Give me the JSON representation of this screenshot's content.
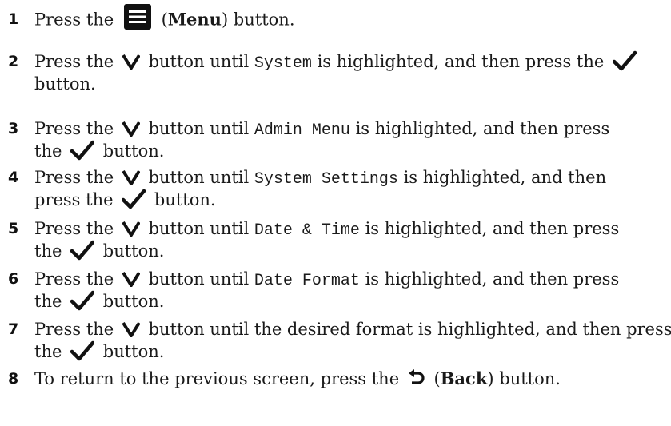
{
  "steps": [
    {
      "n": "1",
      "lines": [
        [
          "Press the ",
          {
            "icon": "menu-icon"
          },
          " (",
          {
            "b": "Menu"
          },
          ") button."
        ]
      ]
    },
    {
      "n": "2",
      "lines": [
        [
          "Press the ",
          {
            "icon": "down-arrow-icon"
          },
          " button until ",
          {
            "m": "System"
          },
          " is highlighted, and then press the ",
          {
            "icon": "check-icon"
          }
        ],
        [
          "button."
        ]
      ]
    },
    {
      "n": "3",
      "lines": [
        [
          "Press the ",
          {
            "icon": "down-arrow-icon"
          },
          " button until ",
          {
            "m": "Admin Menu"
          },
          " is highlighted, and then press"
        ],
        [
          "the ",
          {
            "icon": "check-icon"
          },
          " button."
        ]
      ]
    },
    {
      "n": "4",
      "lines": [
        [
          "Press the ",
          {
            "icon": "down-arrow-icon"
          },
          " button until ",
          {
            "m": "System Settings"
          },
          " is highlighted, and then"
        ],
        [
          "press the ",
          {
            "icon": "check-icon"
          },
          " button."
        ]
      ]
    },
    {
      "n": "5",
      "lines": [
        [
          "Press the ",
          {
            "icon": "down-arrow-icon"
          },
          " button until ",
          {
            "m": "Date & Time"
          },
          " is highlighted, and then press"
        ],
        [
          "the ",
          {
            "icon": "check-icon"
          },
          " button."
        ]
      ]
    },
    {
      "n": "6",
      "lines": [
        [
          "Press the ",
          {
            "icon": "down-arrow-icon"
          },
          " button until ",
          {
            "m": "Date Format"
          },
          " is highlighted, and then press"
        ],
        [
          "the ",
          {
            "icon": "check-icon"
          },
          " button."
        ]
      ]
    },
    {
      "n": "7",
      "lines": [
        [
          "Press the ",
          {
            "icon": "down-arrow-icon"
          },
          " button until the desired format is highlighted, and then press"
        ],
        [
          "the ",
          {
            "icon": "check-icon"
          },
          " button."
        ]
      ]
    },
    {
      "n": "8",
      "lines": [
        [
          "To return to the previous screen, press the ",
          {
            "icon": "back-icon"
          },
          " (",
          {
            "b": "Back"
          },
          ") button."
        ]
      ]
    }
  ]
}
